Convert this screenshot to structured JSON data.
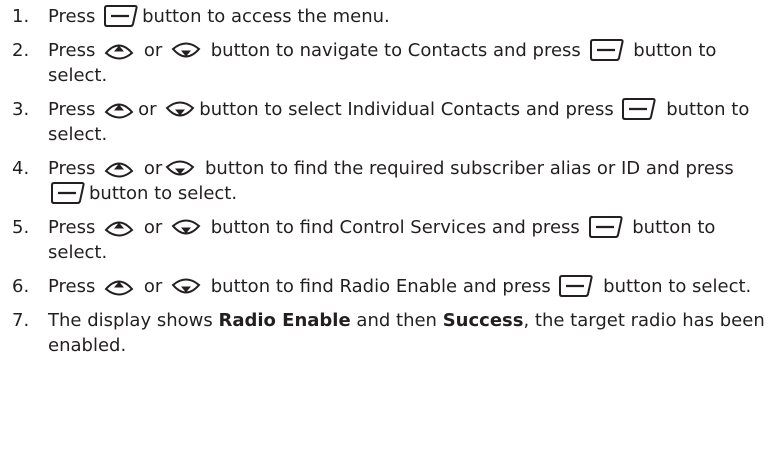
{
  "steps": [
    {
      "num": "1.",
      "t": [
        "Press",
        "button to access the menu."
      ]
    },
    {
      "num": "2.",
      "t": [
        "Press",
        "or",
        "button to navigate to Contacts and press",
        "button to select."
      ]
    },
    {
      "num": "3.",
      "t": [
        "Press",
        "or",
        "button to select Individual Contacts and press",
        "button to select."
      ]
    },
    {
      "num": "4.",
      "t": [
        "Press",
        "or",
        "button to find the required subscriber alias or ID and press",
        "button to select."
      ]
    },
    {
      "num": "5.",
      "t": [
        "Press",
        "or",
        "button to find Control Services and press",
        "button to select."
      ]
    },
    {
      "num": "6.",
      "t": [
        "Press",
        "or",
        "button to find Radio Enable and press",
        "button to select."
      ]
    },
    {
      "num": "7.",
      "t": [
        "The display shows",
        "Radio Enable",
        "and then",
        "Success",
        ", the target radio has been enabled."
      ]
    }
  ]
}
